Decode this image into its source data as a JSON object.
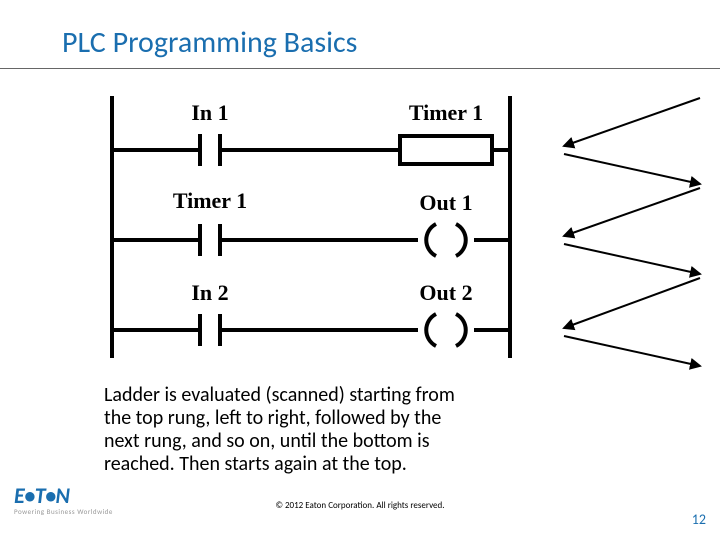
{
  "title": "PLC Programming Basics",
  "ladder": {
    "rungs": [
      {
        "input_label": "In 1",
        "output_label": "Timer 1",
        "output_shape": "box"
      },
      {
        "input_label": "Timer 1",
        "output_label": "Out 1",
        "output_shape": "coil"
      },
      {
        "input_label": "In 2",
        "output_label": "Out 2",
        "output_shape": "coil"
      }
    ]
  },
  "caption": "Ladder is evaluated (scanned) starting from the top rung, left to right, followed by the next rung, and so on, until the bottom is reached.  Then starts again at the top.",
  "copyright": "© 2012 Eaton Corporation. All rights reserved.",
  "page_number": "12",
  "logo": {
    "brand": "E•T•N",
    "tagline": "Powering Business Worldwide"
  }
}
